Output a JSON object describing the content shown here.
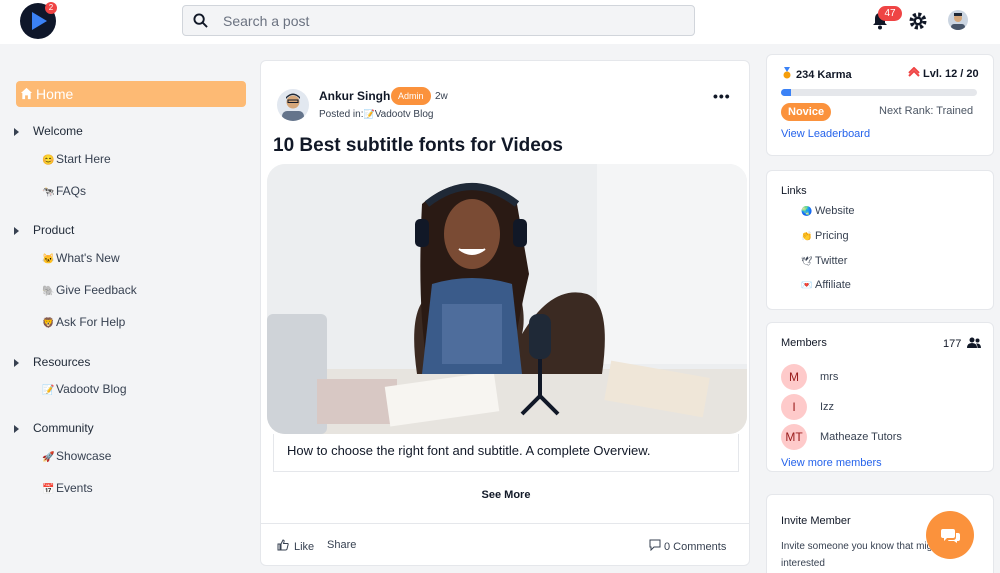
{
  "header": {
    "logo_badge": "2",
    "search": {
      "placeholder": "Search a post"
    },
    "notifications_count": "47"
  },
  "sidebar": {
    "home_label": "Home",
    "sections": [
      {
        "label": "Welcome",
        "items": [
          {
            "emoji": "😊",
            "label": "Start Here"
          },
          {
            "emoji": "🐄",
            "label": "FAQs"
          }
        ]
      },
      {
        "label": "Product",
        "items": [
          {
            "emoji": "🐱",
            "label": "What's New"
          },
          {
            "emoji": "🐘",
            "label": "Give Feedback"
          },
          {
            "emoji": "🦁",
            "label": "Ask For Help"
          }
        ]
      },
      {
        "label": "Resources",
        "items": [
          {
            "emoji": "📝",
            "label": "Vadootv Blog"
          }
        ]
      },
      {
        "label": "Community",
        "items": [
          {
            "emoji": "🚀",
            "label": "Showcase"
          },
          {
            "emoji": "📅",
            "label": "Events"
          }
        ]
      }
    ]
  },
  "post": {
    "author": "Ankur Singh",
    "badge": "Admin",
    "time": "2w",
    "posted_in_prefix": "Posted in:",
    "posted_in_emoji": "📝",
    "posted_in": "Vadootv Blog",
    "menu": "•••",
    "title": "10 Best subtitle fonts for Videos",
    "excerpt": "How to choose the right font and subtitle. A complete Overview.",
    "see_more": "See More",
    "like": "Like",
    "share": "Share",
    "comments": "0 Comments"
  },
  "karma": {
    "karma": "234 Karma",
    "level": "Lvl. 12 / 20",
    "progress": 0.05,
    "rank": "Novice",
    "next_rank": "Next Rank: Trained",
    "leaderboard": "View Leaderboard"
  },
  "links": {
    "title": "Links",
    "items": [
      {
        "emoji": "🌏",
        "label": "Website"
      },
      {
        "emoji": "👏",
        "label": "Pricing"
      },
      {
        "emoji": "🕊",
        "label": "Twitter"
      },
      {
        "emoji": "💌",
        "label": "Affiliate"
      }
    ]
  },
  "members": {
    "title": "Members",
    "count": "177",
    "list": [
      {
        "initials": "M",
        "name": "mrs"
      },
      {
        "initials": "I",
        "name": "Izz"
      },
      {
        "initials": "MT",
        "name": "Matheaze Tutors"
      }
    ],
    "view_more": "View more members"
  },
  "invite": {
    "title": "Invite Member",
    "text": "Invite someone you know that might be interested"
  }
}
